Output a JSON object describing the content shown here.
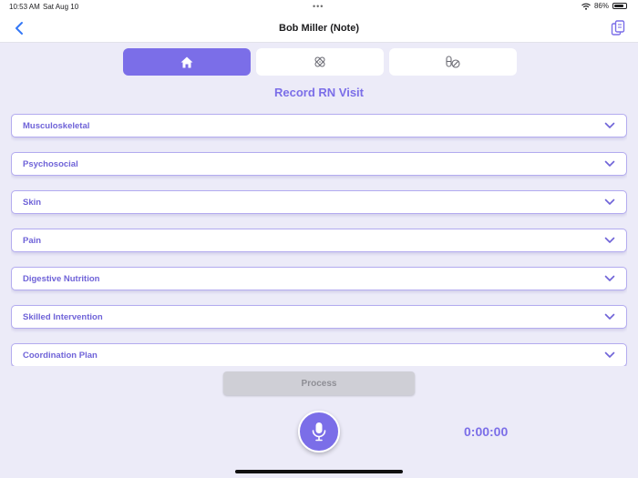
{
  "status_bar": {
    "time": "10:53 AM",
    "date": "Sat Aug 10",
    "dots": "•••",
    "battery": "86%",
    "battery_level": 0.86
  },
  "nav": {
    "title": "Bob Miller (Note)",
    "back_icon": "chevron-left-icon",
    "right_icon": "clipboard-copy-icon"
  },
  "tabs": [
    {
      "icon": "home-icon",
      "active": true
    },
    {
      "icon": "bandage-icon",
      "active": false
    },
    {
      "icon": "pills-icon",
      "active": false
    }
  ],
  "page_title": "Record RN Visit",
  "sections": [
    {
      "label": "Musculoskeletal"
    },
    {
      "label": "Psychosocial"
    },
    {
      "label": "Skin"
    },
    {
      "label": "Pain"
    },
    {
      "label": "Digestive Nutrition"
    },
    {
      "label": "Skilled Intervention"
    },
    {
      "label": "Coordination Plan"
    }
  ],
  "process_button": "Process",
  "timer": "0:00:00",
  "colors": {
    "accent": "#7b6ee8",
    "background": "#ecebf8",
    "section_border": "#b3abef",
    "process_disabled": "#cfcfd6"
  }
}
